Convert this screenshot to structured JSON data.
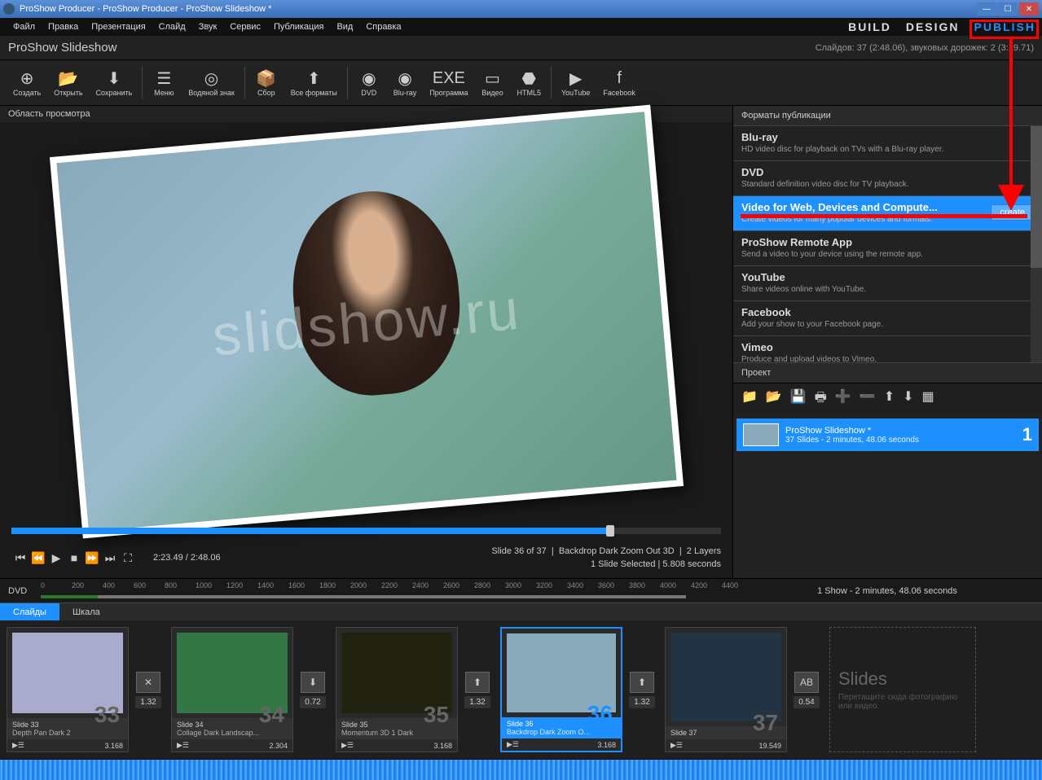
{
  "titlebar": "ProShow Producer - ProShow Producer - ProShow Slideshow *",
  "menu": [
    "Файл",
    "Правка",
    "Презентация",
    "Слайд",
    "Звук",
    "Сервис",
    "Публикация",
    "Вид",
    "Справка"
  ],
  "modes": [
    "BUILD",
    "DESIGN",
    "PUBLISH"
  ],
  "subtitle": "ProShow Slideshow",
  "subtitle_info": "Слайдов: 37 (2:48.06), звуковых дорожек: 2 (3:19.71)",
  "toolbar": [
    {
      "l": "Создать",
      "i": "⊕"
    },
    {
      "l": "Открыть",
      "i": "📂"
    },
    {
      "l": "Сохранить",
      "i": "⬇"
    },
    {
      "sep": true
    },
    {
      "l": "Меню",
      "i": "☰"
    },
    {
      "l": "Водяной знак",
      "i": "◎"
    },
    {
      "sep": true
    },
    {
      "l": "Сбор",
      "i": "📦"
    },
    {
      "l": "Все форматы",
      "i": "⬆"
    },
    {
      "sep": true
    },
    {
      "l": "DVD",
      "i": "◉"
    },
    {
      "l": "Blu-ray",
      "i": "◉"
    },
    {
      "l": "Программа",
      "i": "EXE"
    },
    {
      "l": "Видео",
      "i": "▭"
    },
    {
      "l": "HTML5",
      "i": "⬣"
    },
    {
      "sep": true
    },
    {
      "l": "YouTube",
      "i": "▶"
    },
    {
      "l": "Facebook",
      "i": "f"
    }
  ],
  "preview_header": "Область просмотра",
  "watermark": "slidshow.ru",
  "transport": {
    "time": "2:23.49 / 2:48.06",
    "slide": "Slide 36 of 37",
    "style": "Backdrop Dark Zoom Out 3D",
    "layers": "2 Layers",
    "selection": "1 Slide Selected  |  5.808 seconds"
  },
  "formats_header": "Форматы публикации",
  "formats": [
    {
      "t": "Blu-ray",
      "d": "HD video disc for playback on TVs with a Blu-ray player."
    },
    {
      "t": "DVD",
      "d": "Standard definition video disc for TV playback."
    },
    {
      "t": "Video for Web, Devices and Compute...",
      "d": "Create videos for many popular devices and formats.",
      "sel": true,
      "btn": "create"
    },
    {
      "t": "ProShow Remote App",
      "d": "Send a video to your device using the remote app."
    },
    {
      "t": "YouTube",
      "d": "Share videos online with YouTube."
    },
    {
      "t": "Facebook",
      "d": "Add your show to your Facebook page."
    },
    {
      "t": "Vimeo",
      "d": "Produce and upload videos to Vimeo."
    }
  ],
  "project_header": "Проект",
  "project": {
    "name": "ProShow Slideshow *",
    "sub": "37 Slides - 2 minutes, 48.06 seconds",
    "num": "1"
  },
  "ruler_label": "DVD",
  "ruler_marks": [
    "0",
    "200",
    "400",
    "600",
    "800",
    "1000",
    "1200",
    "1400",
    "1600",
    "1800",
    "2000",
    "2200",
    "2400",
    "2600",
    "2800",
    "3000",
    "3200",
    "3400",
    "3600",
    "3800",
    "4000",
    "4200",
    "4400"
  ],
  "ruler_right": "1 Show - 2 minutes, 48.06 seconds",
  "view_tabs": [
    "Слайды",
    "Шкала"
  ],
  "slides": [
    {
      "n": "33",
      "title": "Slide 33",
      "sub": "Depth Pan Dark 2",
      "dur": "3.168",
      "trans": "1.32",
      "ti": "✕",
      "c": "#aac"
    },
    {
      "n": "34",
      "title": "Slide 34",
      "sub": "Collage Dark Landscap...",
      "dur": "2.304",
      "trans": "0.72",
      "ti": "⬇",
      "c": "#374"
    },
    {
      "n": "35",
      "title": "Slide 35",
      "sub": "Momentum 3D 1 Dark",
      "dur": "3.168",
      "trans": "1.32",
      "ti": "⬆",
      "c": "#221"
    },
    {
      "n": "36",
      "title": "Slide 36",
      "sub": "Backdrop Dark Zoom O...",
      "dur": "3.168",
      "trans": "1.32",
      "ti": "⬆",
      "sel": true,
      "c": "#8ab"
    },
    {
      "n": "37",
      "title": "Slide 37",
      "sub": "",
      "dur": "19.549",
      "trans": "0.54",
      "ti": "AB",
      "c": "#234"
    }
  ],
  "dropzone": {
    "h": "Slides",
    "d": "Перетащите сюда фотографию или видео."
  }
}
